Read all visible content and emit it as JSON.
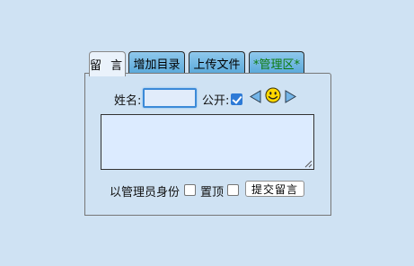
{
  "tabs": [
    {
      "label": "留 言",
      "active": true
    },
    {
      "label": "增加目录",
      "active": false
    },
    {
      "label": "上传文件",
      "active": false
    },
    {
      "label": "*管理区*",
      "active": false,
      "color": "#0d7a0d"
    }
  ],
  "form": {
    "name_label": "姓名:",
    "name_value": "",
    "public_label": "公开:",
    "public_checked": true,
    "emoji_icon": "smiley-face-icon",
    "message_value": "",
    "admin_label": "以管理员身份",
    "admin_checked": false,
    "pin_label": "置顶",
    "pin_checked": false,
    "submit_label": "提交留言"
  },
  "colors": {
    "background": "#cfe2f3",
    "tab_fill": "#5aa9da",
    "checkbox_accent": "#2d7ad6",
    "emoji_yellow": "#ffd800"
  }
}
